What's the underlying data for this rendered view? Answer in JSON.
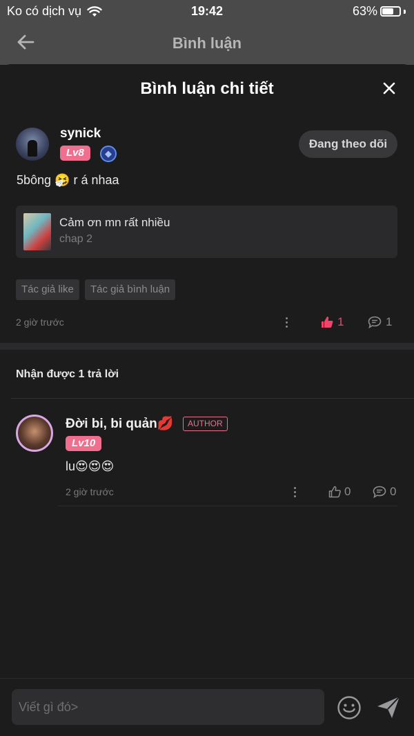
{
  "status_bar": {
    "carrier": "Ko có dịch vụ",
    "time": "19:42",
    "battery": "63%"
  },
  "header": {
    "title": "Bình luận"
  },
  "sheet": {
    "title": "Bình luận chi tiết",
    "comment": {
      "username": "synick",
      "level": "Lv8",
      "follow_label": "Đang theo dõi",
      "text": "5bông 🤧 r á nhaa",
      "chapter": {
        "title": "Cảm ơn mn rất nhiều",
        "subtitle": "chap 2"
      },
      "tags": [
        "Tác giả like",
        "Tác giả bình luận"
      ],
      "time": "2 giờ trước",
      "likes": "1",
      "replies": "1"
    },
    "reply_count_label": "Nhận được 1 trả lời",
    "replies": [
      {
        "username": "Đời bi, bi quản💋",
        "badge": "AUTHOR",
        "level": "Lv10",
        "text": "lu😍😍😍",
        "time": "2 giờ trước",
        "likes": "0",
        "replies": "0"
      }
    ]
  },
  "input": {
    "placeholder": "Viết gì đó>"
  },
  "colors": {
    "accent": "#f0446a",
    "badge": "#f06f8f",
    "background": "#1c1c1d"
  }
}
